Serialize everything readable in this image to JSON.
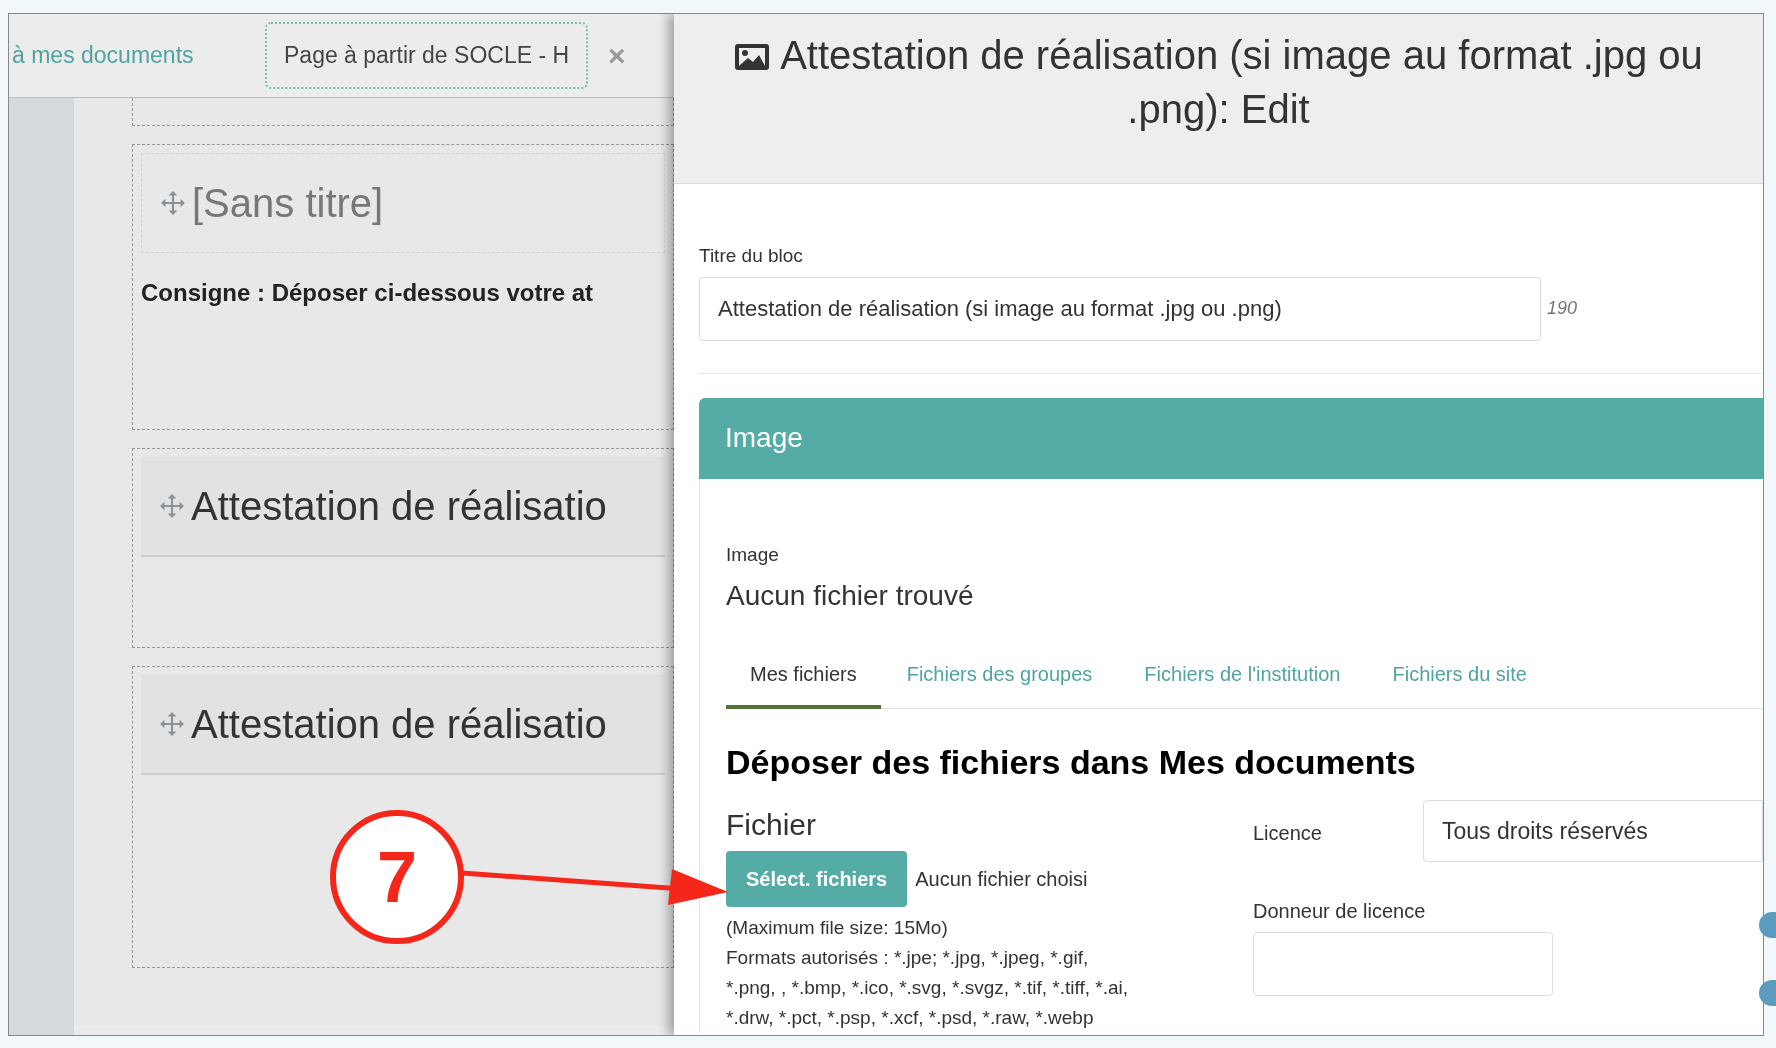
{
  "top_bar": {
    "back_link": "à mes documents",
    "page_tab": "Page à partir de SOCLE - H",
    "close": "×"
  },
  "blocks": [
    {
      "title": "[Sans titre]",
      "untitled": true,
      "instruction": "Consigne : Déposer ci-dessous votre at"
    },
    {
      "title": "Attestation de réalisatio",
      "untitled": false
    },
    {
      "title": "Attestation de réalisatio",
      "untitled": false
    }
  ],
  "modal": {
    "title": "Attestation de réalisation (si image au format .jpg ou .png): Edit",
    "block_title_label": "Titre du bloc",
    "block_title_value": "Attestation de réalisation (si image au format .jpg ou .png)",
    "char_count": "190",
    "section": "Image",
    "image_label": "Image",
    "image_status": "Aucun fichier trouvé",
    "tabs": [
      {
        "label": "Mes fichiers",
        "selected": true
      },
      {
        "label": "Fichiers des groupes",
        "selected": false
      },
      {
        "label": "Fichiers de l'institution",
        "selected": false
      },
      {
        "label": "Fichiers du site",
        "selected": false
      }
    ],
    "upload_heading": "Déposer des fichiers dans Mes documents",
    "file_label": "Fichier",
    "select_button": "Sélect. fichiers",
    "no_file": "Aucun fichier choisi",
    "max_size": "(Maximum file size: 15Mo)",
    "formats": [
      "Formats autorisés : *.jpe; *.jpg, *.jpeg, *.gif,",
      "*.png, , *.bmp, *.ico, *.svg, *.svgz, *.tif, *.tiff, *.ai,",
      "*.drw, *.pct, *.psp, *.xcf, *.psd, *.raw, *.webp"
    ],
    "licence_label": "Licence",
    "licence_value": "Tous droits réservés",
    "licensor_label": "Donneur de licence"
  },
  "annotation": {
    "label": "7"
  }
}
